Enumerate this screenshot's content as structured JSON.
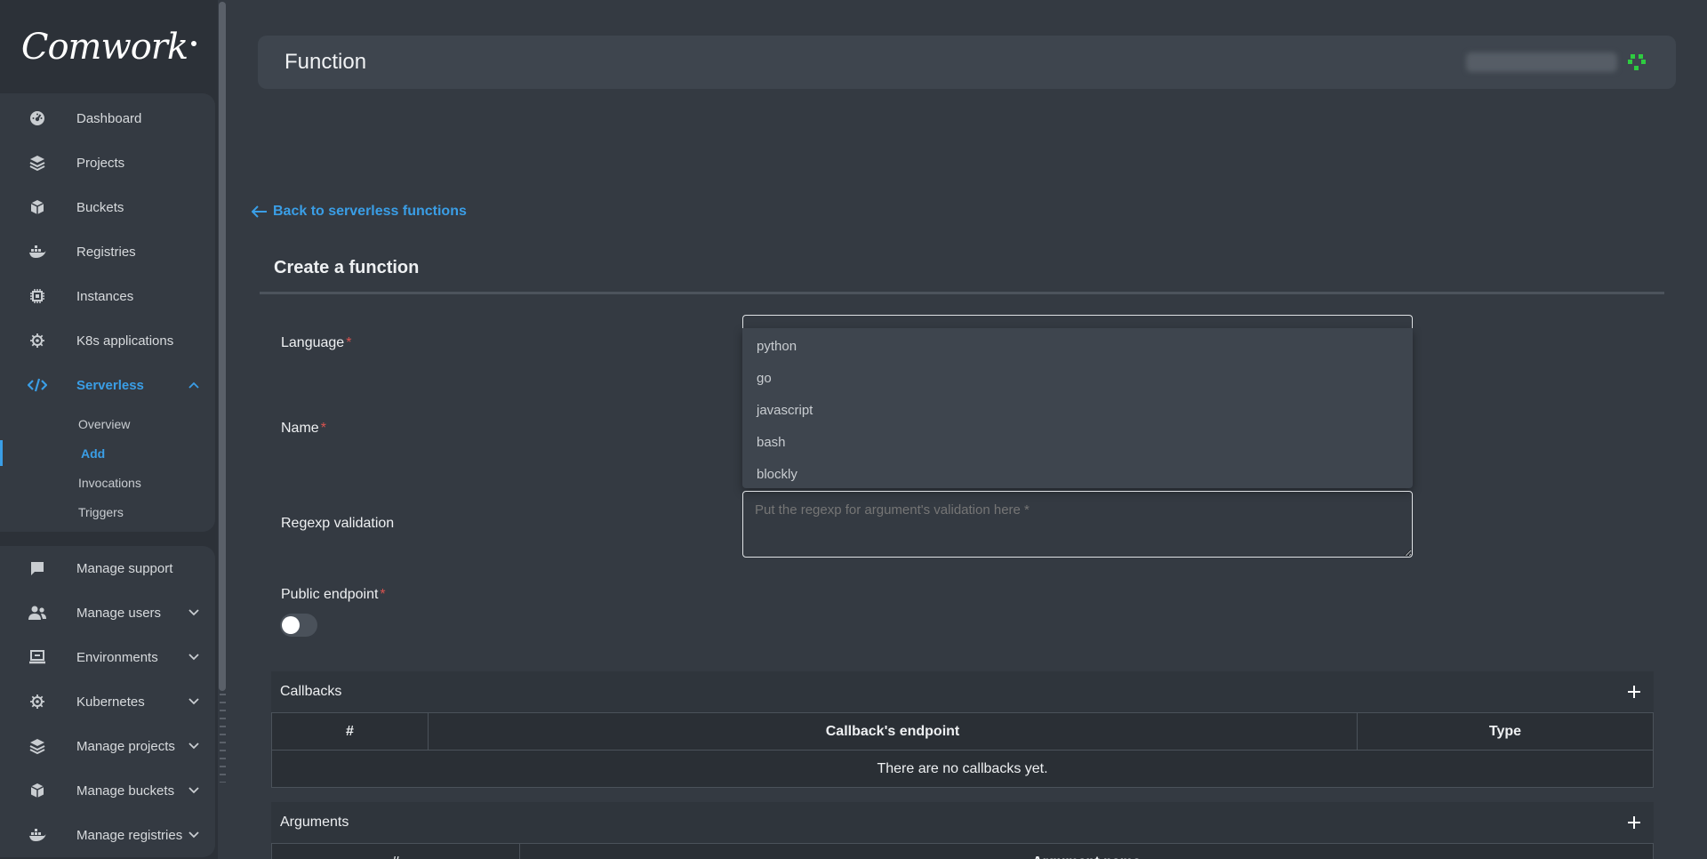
{
  "brand": {
    "logo_text": "Comwork"
  },
  "sidebar": {
    "top_items": [
      {
        "label": "Dashboard",
        "icon": "dashboard-icon"
      },
      {
        "label": "Projects",
        "icon": "layers-icon"
      },
      {
        "label": "Buckets",
        "icon": "box-icon"
      },
      {
        "label": "Registries",
        "icon": "docker-icon"
      },
      {
        "label": "Instances",
        "icon": "chip-icon"
      },
      {
        "label": "K8s applications",
        "icon": "helm-icon"
      },
      {
        "label": "Serverless",
        "icon": "code-icon",
        "active": true
      }
    ],
    "serverless_sub": [
      {
        "label": "Overview"
      },
      {
        "label": "Add",
        "active": true
      },
      {
        "label": "Invocations"
      },
      {
        "label": "Triggers"
      }
    ],
    "bottom_items": [
      {
        "label": "Manage support",
        "icon": "chat-icon"
      },
      {
        "label": "Manage users",
        "icon": "users-icon"
      },
      {
        "label": "Environments",
        "icon": "monitor-icon"
      },
      {
        "label": "Kubernetes",
        "icon": "helm-icon"
      },
      {
        "label": "Manage projects",
        "icon": "layers-icon"
      },
      {
        "label": "Manage buckets",
        "icon": "box-icon"
      },
      {
        "label": "Manage registries",
        "icon": "docker-icon"
      }
    ]
  },
  "header": {
    "title": "Function"
  },
  "back_link": {
    "label": "Back to serverless functions"
  },
  "form": {
    "title": "Create a function",
    "language_label": "Language",
    "name_label": "Name",
    "regexp_label": "Regexp validation",
    "regexp_placeholder": "Put the regexp for argument's validation here *",
    "public_endpoint_label": "Public endpoint",
    "required_mark": "*",
    "language_options": [
      "python",
      "go",
      "javascript",
      "bash",
      "blockly"
    ],
    "public_endpoint_on": false
  },
  "callbacks": {
    "title": "Callbacks",
    "columns": [
      "#",
      "Callback's endpoint",
      "Type"
    ],
    "empty_text": "There are no callbacks yet."
  },
  "arguments": {
    "title": "Arguments",
    "columns": [
      "#",
      "Argument name"
    ]
  },
  "colors": {
    "accent": "#3a9ee6",
    "required": "#d9534f",
    "status": "#2ecc40"
  }
}
